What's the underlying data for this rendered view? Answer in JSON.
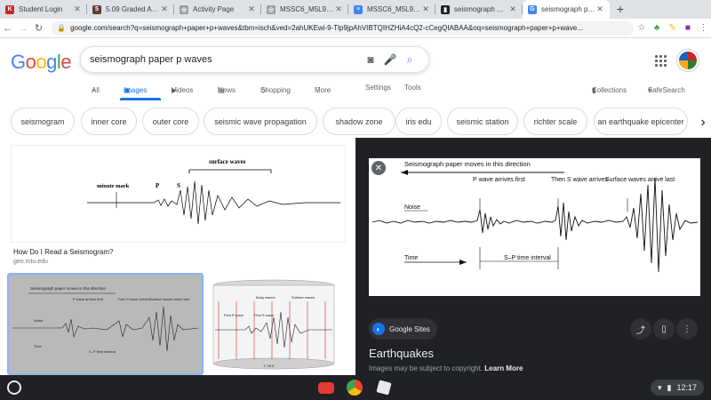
{
  "browser": {
    "tabs": [
      {
        "title": "Student Login",
        "icon": "k12-icon",
        "color": "#c62828",
        "glyph": "K"
      },
      {
        "title": "5.09 Graded Assignment",
        "icon": "assignment-icon",
        "color": "#5d4037",
        "glyph": "5"
      },
      {
        "title": "Activity Page",
        "icon": "globe-icon",
        "color": "#9e9e9e",
        "glyph": "◎"
      },
      {
        "title": "MSSC6_M5L9_TG",
        "icon": "globe-icon",
        "color": "#9e9e9e",
        "glyph": "◎"
      },
      {
        "title": "MSSC6_M5L9_TG",
        "icon": "docs-icon",
        "color": "#4285f4",
        "glyph": "≡"
      },
      {
        "title": "seismograph Design",
        "icon": "bookmark-icon",
        "color": "#202124",
        "glyph": "▮"
      },
      {
        "title": "seismograph paper p waves",
        "icon": "google-icon",
        "color": "#4285f4",
        "glyph": "G",
        "active": true
      }
    ],
    "new_tab": "+",
    "url": "google.com/search?q=seismograph+paper+p+waves&tbm=isch&ved=2ahUKEwi-9-Tlp9jpAhVIBTQIHZHiA4cQ2-cCegQIABAA&oq=seismograph+paper+p+wave..."
  },
  "search": {
    "logo": "Google",
    "query": "seismograph paper p waves",
    "nav": {
      "all": "All",
      "images": "Images",
      "videos": "Videos",
      "news": "News",
      "shopping": "Shopping",
      "more": "More",
      "settings": "Settings",
      "tools": "Tools",
      "collections": "Collections",
      "safesearch": "SafeSearch"
    }
  },
  "chips": [
    "seismogram",
    "inner core",
    "outer core",
    "seismic wave propagation",
    "shadow zone",
    "iris edu",
    "seismic station",
    "richter scale",
    "an earthquake epicenter"
  ],
  "results": {
    "first": {
      "caption": "How Do I Read a Seismogram?",
      "source": "geo.mtu.edu",
      "labels": {
        "minute": "minute mark",
        "p": "P",
        "s": "S",
        "surface": "surface waves"
      }
    },
    "second": {
      "header": "Seismograph paper moves in this direction",
      "p": "P wave arrives first",
      "s": "Then S wave arrives",
      "surface": "Surface waves arrive last",
      "noise": "Noise",
      "time": "Time",
      "sp": "S–P time interval"
    },
    "third": {
      "body": "Body waves",
      "surface": "Surface waves",
      "first_p": "First P wave",
      "first_s": "First S wave",
      "time": "T I M E"
    }
  },
  "panel": {
    "header": "Seismograph paper moves in this direction",
    "p_arrives": "P wave arrives first",
    "s_arrives": "Then S wave arrives",
    "surface_arrive": "Surface waves arrive last",
    "noise": "Noise",
    "time": "Time",
    "sp_interval": "S–P time interval",
    "source": "Google Sites",
    "title": "Earthquakes",
    "note": "Images may be subject to copyright.",
    "learn_more": "Learn More"
  },
  "taskbar": {
    "time": "12:17"
  }
}
